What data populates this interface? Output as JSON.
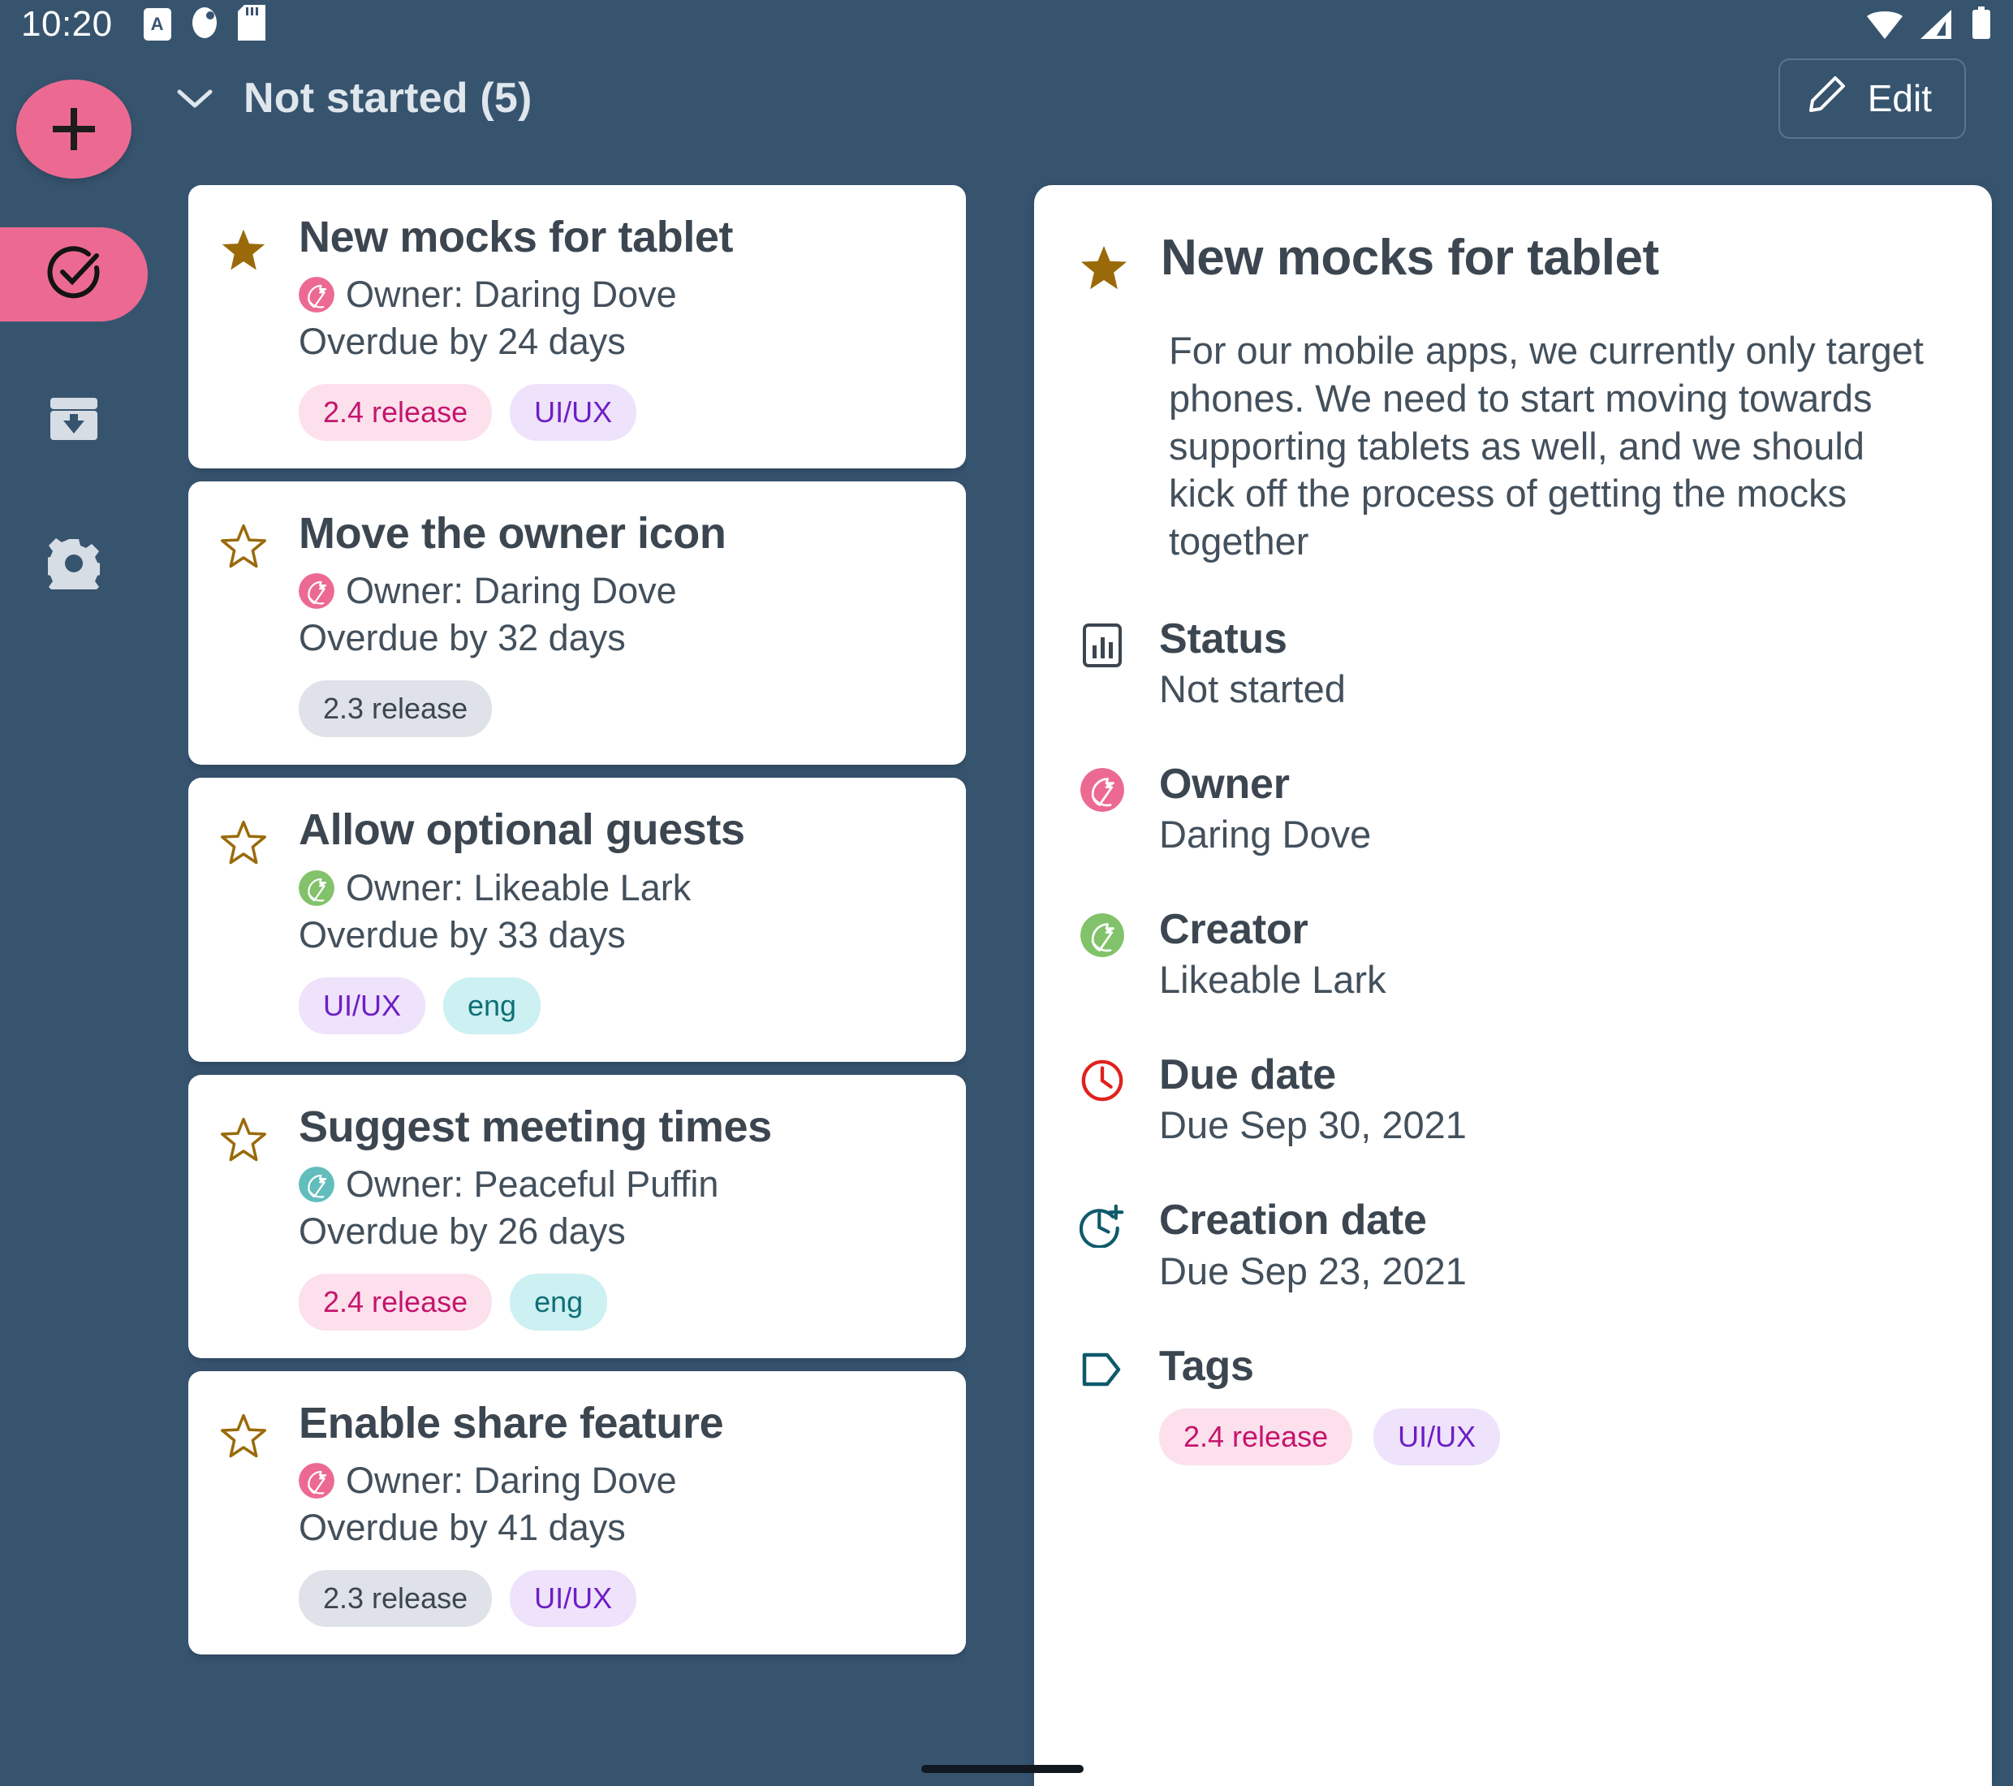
{
  "status_bar": {
    "time": "10:20",
    "left_icons": [
      "a-badge-icon",
      "app-notification-icon",
      "sd-card-icon"
    ],
    "right_icons": [
      "wifi-icon",
      "cellular-signal-icon",
      "battery-icon"
    ]
  },
  "sidebar": {
    "add_label": "+",
    "items": [
      {
        "name": "tasks",
        "icon": "check-circle-icon",
        "active": true
      },
      {
        "name": "archive",
        "icon": "archive-inbox-icon",
        "active": false
      },
      {
        "name": "settings",
        "icon": "gear-icon",
        "active": false
      }
    ]
  },
  "header": {
    "collapse_icon": "chevron-down-icon",
    "title": "Not started (5)",
    "edit_label": "Edit",
    "edit_icon": "pencil-icon"
  },
  "colors": {
    "background": "#37546f",
    "accent_pink": "#ec6a92",
    "star_gold": "#9a6a0a",
    "text_dark": "#3c4650",
    "due_red": "#e0211d",
    "creation_teal": "#0e5a6b",
    "tag_icon": "#0e5a6b"
  },
  "task_list": [
    {
      "title": "New mocks for tablet",
      "starred": true,
      "owner_label": "Owner: Daring Dove",
      "owner_color": "#ec6a92",
      "due_label": "Overdue by 24 days",
      "tags": [
        {
          "label": "2.4 release",
          "style": "pink"
        },
        {
          "label": "UI/UX",
          "style": "purple"
        }
      ]
    },
    {
      "title": "Move the owner icon",
      "starred": false,
      "owner_label": "Owner: Daring Dove",
      "owner_color": "#ec6a92",
      "due_label": "Overdue by 32 days",
      "tags": [
        {
          "label": "2.3 release",
          "style": "grey"
        }
      ]
    },
    {
      "title": "Allow optional guests",
      "starred": false,
      "owner_label": "Owner: Likeable Lark",
      "owner_color": "#82c26a",
      "due_label": "Overdue by 33 days",
      "tags": [
        {
          "label": "UI/UX",
          "style": "purple"
        },
        {
          "label": "eng",
          "style": "cyan"
        }
      ]
    },
    {
      "title": "Suggest meeting times",
      "starred": false,
      "owner_label": "Owner: Peaceful Puffin",
      "owner_color": "#62bdbd",
      "due_label": "Overdue by 26 days",
      "tags": [
        {
          "label": "2.4 release",
          "style": "pink"
        },
        {
          "label": "eng",
          "style": "cyan"
        }
      ]
    },
    {
      "title": "Enable share feature",
      "starred": false,
      "owner_label": "Owner: Daring Dove",
      "owner_color": "#ec6a92",
      "due_label": "Overdue by 41 days",
      "tags": [
        {
          "label": "2.3 release",
          "style": "grey"
        },
        {
          "label": "UI/UX",
          "style": "purple"
        }
      ]
    }
  ],
  "detail": {
    "starred": true,
    "title": "New mocks for tablet",
    "description": "For our mobile apps, we currently only target phones. We need to start moving towards supporting tablets as well, and we should kick off the process of getting the mocks together",
    "fields": [
      {
        "icon": "bar-chart-icon",
        "label": "Status",
        "value": "Not started"
      },
      {
        "icon": "bird-avatar-pink-icon",
        "label": "Owner",
        "value": "Daring Dove"
      },
      {
        "icon": "bird-avatar-green-icon",
        "label": "Creator",
        "value": "Likeable Lark"
      },
      {
        "icon": "clock-icon",
        "label": "Due date",
        "value": "Due Sep 30, 2021"
      },
      {
        "icon": "clock-plus-icon",
        "label": "Creation date",
        "value": "Due Sep 23, 2021"
      }
    ],
    "tags_label": "Tags",
    "tags_icon": "tag-icon",
    "tags": [
      {
        "label": "2.4 release",
        "style": "pink"
      },
      {
        "label": "UI/UX",
        "style": "purple"
      }
    ]
  }
}
